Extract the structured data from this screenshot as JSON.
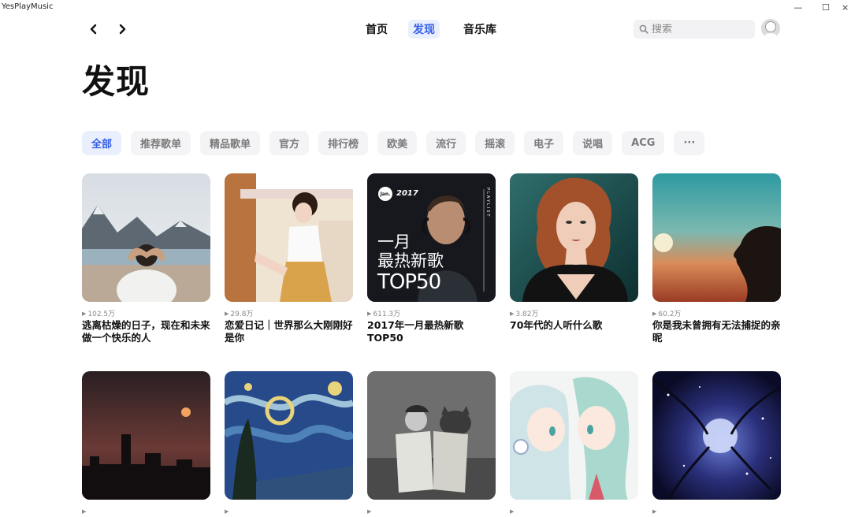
{
  "window": {
    "title": "YesPlayMusic"
  },
  "nav": {
    "tabs": [
      {
        "label": "首页"
      },
      {
        "label": "发现",
        "active": true
      },
      {
        "label": "音乐库"
      }
    ]
  },
  "search": {
    "placeholder": "搜索",
    "value": ""
  },
  "page": {
    "title": "发现"
  },
  "categories": [
    {
      "label": "全部",
      "active": true
    },
    {
      "label": "推荐歌单"
    },
    {
      "label": "精品歌单"
    },
    {
      "label": "官方"
    },
    {
      "label": "排行榜"
    },
    {
      "label": "欧美"
    },
    {
      "label": "流行"
    },
    {
      "label": "摇滚"
    },
    {
      "label": "电子"
    },
    {
      "label": "说唱"
    },
    {
      "label": "ACG"
    },
    {
      "label": "···"
    }
  ],
  "playlists": [
    {
      "plays": "102.5万",
      "title": "逃离枯燥的日子，现在和未来做一个快乐的人"
    },
    {
      "plays": "29.8万",
      "title": "恋爱日记｜世界那么大刚刚好是你"
    },
    {
      "plays": "611.3万",
      "title": "2017年一月最热新歌TOP50",
      "cover_text": {
        "badge": "Jan.",
        "year": "2017",
        "side": "PLAYLIST",
        "line1": "一月",
        "line2": "最热新歌",
        "line3": "TOP50"
      }
    },
    {
      "plays": "3.82万",
      "title": "70年代的人听什么歌"
    },
    {
      "plays": "60.2万",
      "title": "你是我未曾拥有无法捕捉的亲昵"
    },
    {
      "plays": "",
      "title": ""
    },
    {
      "plays": "",
      "title": ""
    },
    {
      "plays": "",
      "title": ""
    },
    {
      "plays": "",
      "title": ""
    },
    {
      "plays": "",
      "title": ""
    }
  ],
  "colors": {
    "accent": "#335eea",
    "accent_bg": "#eaeffd",
    "chip_bg": "#f4f4f6"
  }
}
